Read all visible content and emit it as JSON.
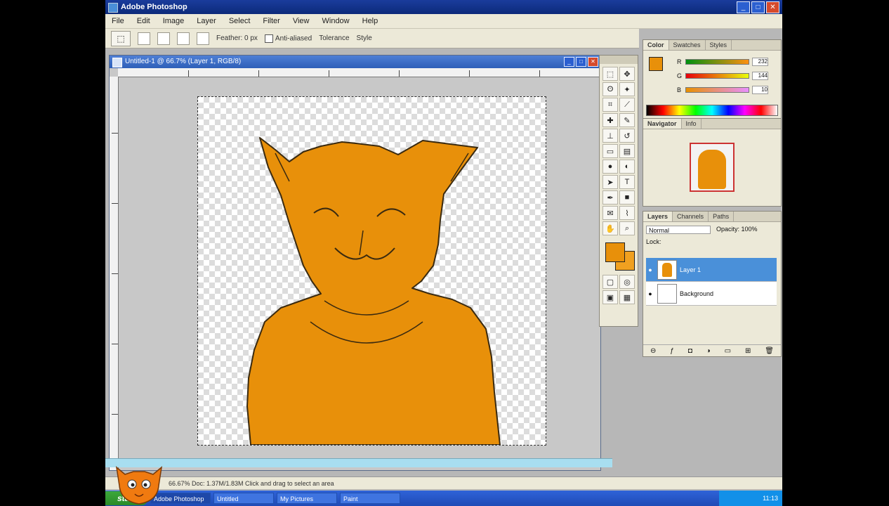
{
  "app": {
    "title": "Adobe Photoshop"
  },
  "menubar": {
    "items": [
      "File",
      "Edit",
      "Image",
      "Layer",
      "Select",
      "Filter",
      "View",
      "Window",
      "Help"
    ]
  },
  "options": {
    "feather_label": "Feather: 0 px",
    "antialiased_label": "Anti-aliased",
    "tolerance_label": "Tolerance",
    "style_label": "Style"
  },
  "document": {
    "title": "Untitled-1 @ 66.7% (Layer 1, RGB/8)"
  },
  "tools": {
    "icons": [
      "marquee-icon",
      "move-icon",
      "lasso-icon",
      "magic-wand-icon",
      "crop-icon",
      "slice-icon",
      "heal-icon",
      "brush-icon",
      "stamp-icon",
      "history-brush-icon",
      "eraser-icon",
      "gradient-icon",
      "blur-icon",
      "dodge-icon",
      "path-select-icon",
      "type-icon",
      "pen-icon",
      "shape-icon",
      "notes-icon",
      "eyedropper-icon",
      "hand-icon",
      "zoom-icon"
    ]
  },
  "colors": {
    "foreground": "#e8900a",
    "background": "#f0a020"
  },
  "color_panel": {
    "tabs": [
      "Color",
      "Swatches",
      "Styles"
    ],
    "r": "232",
    "g": "144",
    "b": "10"
  },
  "navigator_panel": {
    "tabs": [
      "Navigator",
      "Info"
    ]
  },
  "layers_panel": {
    "tabs": [
      "Layers",
      "Channels",
      "Paths"
    ],
    "blend_mode": "Normal",
    "opacity_label": "Opacity: 100%",
    "lock_label": "Lock:",
    "layers": [
      {
        "name": "Layer 1",
        "selected": true
      },
      {
        "name": "Background",
        "selected": false
      }
    ]
  },
  "statusbar": {
    "text": "66.67%   Doc: 1.37M/1.83M   Click and drag to select an area"
  },
  "taskbar": {
    "start_label": "start",
    "tasks": [
      "Adobe Photoshop",
      "Untitled",
      "My Pictures",
      "Paint"
    ],
    "clock": "11:13"
  }
}
